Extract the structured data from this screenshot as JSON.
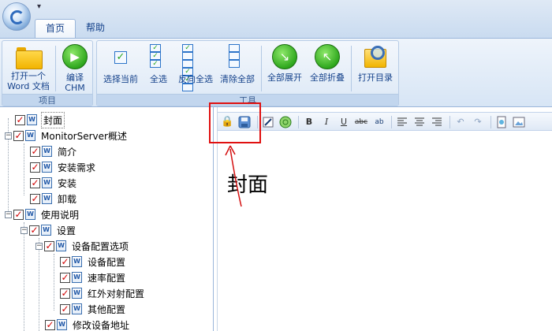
{
  "title_bar": {
    "qat_glyph": "▾"
  },
  "tabs": [
    {
      "label": "首页"
    },
    {
      "label": "帮助"
    }
  ],
  "ribbon": {
    "project_group": {
      "label": "项目",
      "open_word_line1": "打开一个",
      "open_word_line2": "Word 文档",
      "compile_line1": "编译",
      "compile_line2": "CHM"
    },
    "tools_group": {
      "label": "工具",
      "select_current": "选择当前",
      "select_all": "全选",
      "invert_select": "反向全选",
      "clear_all": "清除全部",
      "expand_all": "全部展开",
      "collapse_all": "全部折叠",
      "open_dir": "打开目录"
    }
  },
  "tree": {
    "items": [
      {
        "label": "封面"
      },
      {
        "label": "MonitorServer概述"
      },
      {
        "label": "简介"
      },
      {
        "label": "安装需求"
      },
      {
        "label": "安装"
      },
      {
        "label": "卸载"
      },
      {
        "label": "使用说明"
      },
      {
        "label": "设置"
      },
      {
        "label": "设备配置选项"
      },
      {
        "label": "设备配置"
      },
      {
        "label": "速率配置"
      },
      {
        "label": "红外对射配置"
      },
      {
        "label": "其他配置"
      },
      {
        "label": "修改设备地址"
      }
    ]
  },
  "editor": {
    "heading": "封面",
    "toolbar": {
      "bold": "B",
      "italic": "I",
      "underline": "U",
      "strike": "abc",
      "spell": "ab"
    }
  }
}
